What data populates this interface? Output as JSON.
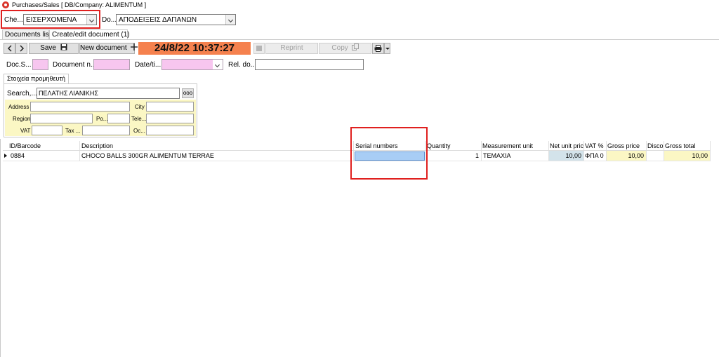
{
  "window": {
    "title": "Purchases/Sales   [ DB/Company: ALIMENTUM ]"
  },
  "top": {
    "che_label": "Che...",
    "che_value": "ΕΙΣΕΡΧΟΜΕΝΑ",
    "do_label": "Do...",
    "do_value": "ΑΠΟΔΕΙΞΕΙΣ ΔΑΠΑΝΩΝ"
  },
  "tabs": [
    {
      "label": "Documents list"
    },
    {
      "label": "Create/edit document (1)"
    }
  ],
  "toolbar": {
    "save_label": "Save",
    "new_document_label": "New document",
    "datetime": "24/8/22 10:37:27",
    "reprint_label": "Reprint",
    "copy_label": "Copy"
  },
  "docfields": {
    "doc_series_label": "Doc.S...",
    "doc_number_label": "Document n...",
    "date_time_label": "Date/ti...",
    "related_doc_label": "Rel. do..."
  },
  "supplier": {
    "tab_label": "Στοιχεία προμηθευτή",
    "search_label": "Search,...",
    "search_value": "ΠΕΛΑΤΗΣ ΛΙΑΝΙΚΗΣ",
    "more_label": "ooo",
    "address_label": "Address",
    "city_label": "City",
    "region_label": "Region",
    "postal_label": "Po...",
    "phone_label": "Tele...",
    "vat_label": "VAT",
    "tax_office_label": "Tax ...",
    "occupation_label": "Oc..."
  },
  "grid": {
    "columns": [
      "ID/Barcode",
      "Description",
      "Serial numbers",
      "Quantity",
      "Measurement unit",
      "Net unit pric",
      "VAT %",
      "Gross price",
      "Disco",
      "Gross total"
    ],
    "rows": [
      {
        "id": "0884",
        "description": "CHOCO BALLS 300GR ALIMENTUM TERRAE",
        "serial": "",
        "quantity": "1",
        "unit": "TEMAXIA",
        "net_price": "10,00",
        "vat": "ΦΠΑ 0",
        "gross_price": "10,00",
        "discount": "",
        "gross_total": "10,00"
      }
    ]
  },
  "colors": {
    "highlight_red": "#e0201f",
    "clock_bg": "#f5814e",
    "pink_field": "#f7c6ef",
    "supplier_yellow": "#fbf7c4",
    "serial_cell_blue": "#a8cdf5"
  }
}
